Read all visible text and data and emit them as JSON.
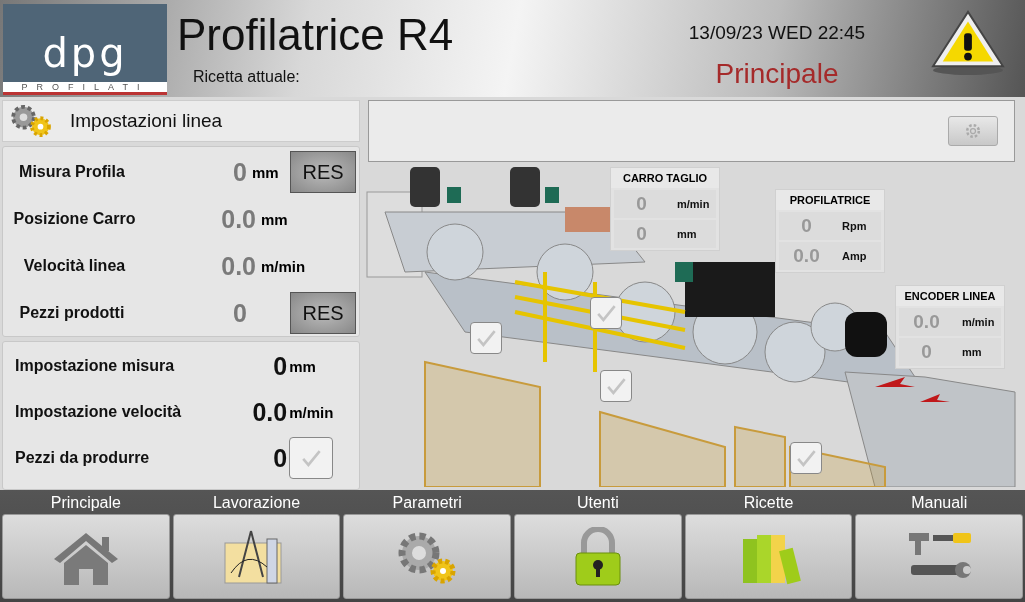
{
  "header": {
    "logo_text": "dpg",
    "logo_subtitle": "PROFILATI",
    "title": "Profilatrice R4",
    "recipe_label": "Ricetta attuale:",
    "datetime": "13/09/23 WED 22:45",
    "page_title": "Principale"
  },
  "line_panel": {
    "title": "Impostazioni linea",
    "readings": [
      {
        "label": "Misura Profila",
        "value": "0",
        "unit": "mm",
        "button": "RES"
      },
      {
        "label": "Posizione Carro",
        "value": "0.0",
        "unit": "mm"
      },
      {
        "label": "Velocità linea",
        "value": "0.0",
        "unit": "m/min"
      },
      {
        "label": "Pezzi prodotti",
        "value": "0",
        "button": "RES"
      }
    ],
    "settings": [
      {
        "kind": "unit",
        "label": "Impostazione misura",
        "value": "0",
        "unit": "mm"
      },
      {
        "kind": "unit",
        "label": "Impostazione velocità",
        "value": "0.0",
        "unit": "m/min"
      },
      {
        "kind": "confirm",
        "label": "Pezzi da produrre",
        "value": "0"
      }
    ]
  },
  "machine": {
    "readouts": [
      {
        "title": "CARRO TAGLIO",
        "rows": [
          {
            "value": "0",
            "unit": "m/min"
          },
          {
            "value": "0",
            "unit": "mm"
          }
        ]
      },
      {
        "title": "PROFILATRICE",
        "rows": [
          {
            "value": "0",
            "unit": "Rpm"
          },
          {
            "value": "0.0",
            "unit": "Amp"
          }
        ]
      },
      {
        "title": "ENCODER LINEA",
        "rows": [
          {
            "value": "0.0",
            "unit": "m/min"
          },
          {
            "value": "0",
            "unit": "mm"
          }
        ]
      }
    ]
  },
  "nav": [
    {
      "label": "Principale",
      "kind": "home"
    },
    {
      "label": "Lavorazione",
      "kind": "drafting"
    },
    {
      "label": "Parametri",
      "kind": "gears"
    },
    {
      "label": "Utenti",
      "kind": "lock"
    },
    {
      "label": "Ricette",
      "kind": "folders"
    },
    {
      "label": "Manuali",
      "kind": "tools"
    }
  ]
}
